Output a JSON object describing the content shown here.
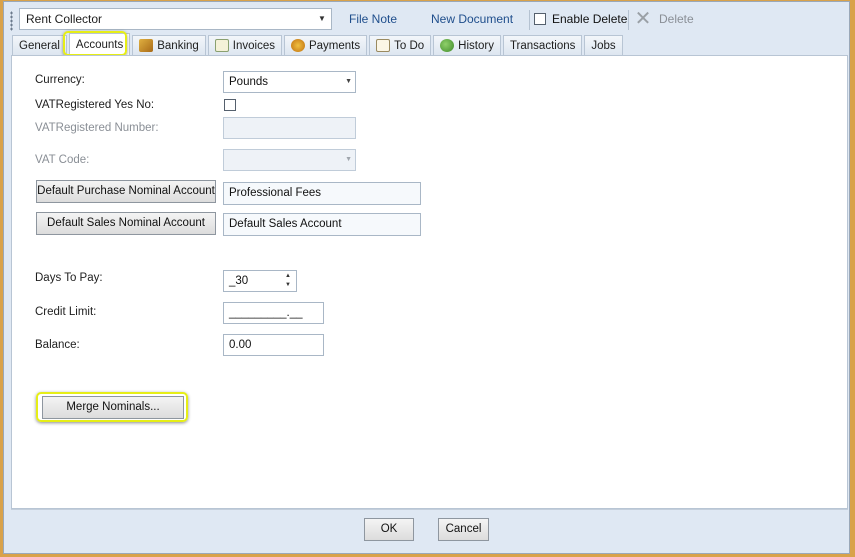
{
  "toolbar": {
    "entity_value": "Rent Collector",
    "file_note": "File Note",
    "new_document": "New Document",
    "enable_delete": "Enable Delete",
    "delete": "Delete"
  },
  "tabs": [
    {
      "label": "General"
    },
    {
      "label": "Accounts"
    },
    {
      "label": "Banking"
    },
    {
      "label": "Invoices"
    },
    {
      "label": "Payments"
    },
    {
      "label": "To Do"
    },
    {
      "label": "History"
    },
    {
      "label": "Transactions"
    },
    {
      "label": "Jobs"
    }
  ],
  "form": {
    "currency_label": "Currency:",
    "currency_value": "Pounds",
    "vat_registered_label": "VATRegistered Yes No:",
    "vat_number_label": "VATRegistered Number:",
    "vat_code_label": "VAT Code:",
    "purchase_btn": "Default Purchase Nominal Account",
    "purchase_value": "Professional Fees",
    "sales_btn": "Default Sales Nominal Account",
    "sales_value": "Default Sales Account",
    "days_label": "Days To Pay:",
    "days_value": "_30",
    "credit_label": "Credit Limit:",
    "credit_value": "_________.__",
    "balance_label": "Balance:",
    "balance_value": "0.00",
    "merge_btn": "Merge Nominals..."
  },
  "footer": {
    "ok": "OK",
    "cancel": "Cancel"
  },
  "colors": {
    "highlight": "#e6ee16",
    "link": "#1f4e8c",
    "window_bg": "#dfe8f3"
  }
}
